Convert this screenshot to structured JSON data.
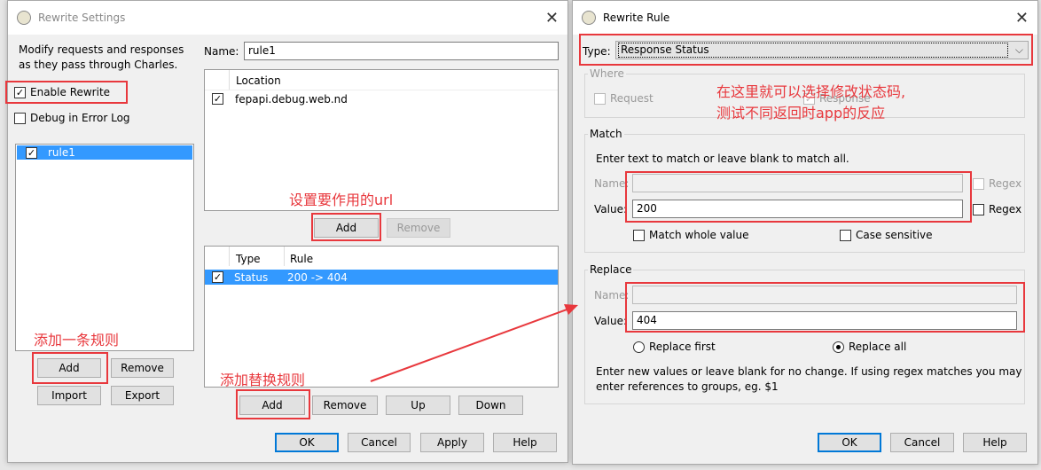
{
  "settings": {
    "title": "Rewrite Settings",
    "description_1": "Modify requests and responses",
    "description_2": "as they pass through Charles.",
    "enable_rewrite": "Enable Rewrite",
    "debug_log": "Debug in Error Log",
    "rules": [
      {
        "name": "rule1",
        "checked": true
      }
    ],
    "add": "Add",
    "remove": "Remove",
    "import": "Import",
    "export": "Export",
    "name_label": "Name:",
    "name_value": "rule1",
    "location_header": "Location",
    "locations": [
      {
        "value": "fepapi.debug.web.nd",
        "checked": true
      }
    ],
    "loc_add": "Add",
    "loc_remove": "Remove",
    "rule_headers": {
      "type": "Type",
      "rule": "Rule"
    },
    "rule_rows": [
      {
        "type": "Status",
        "rule": "200 -> 404",
        "checked": true
      }
    ],
    "rule_add": "Add",
    "rule_remove": "Remove",
    "up": "Up",
    "down": "Down",
    "ok": "OK",
    "cancel": "Cancel",
    "apply": "Apply",
    "help": "Help"
  },
  "rule": {
    "title": "Rewrite Rule",
    "type_label": "Type:",
    "type_value": "Response Status",
    "where": "Where",
    "request": "Request",
    "response": "Response",
    "match": "Match",
    "match_hint": "Enter text to match or leave blank to match all.",
    "name_label": "Name:",
    "value_label": "Value:",
    "match_value": "200",
    "regex": "Regex",
    "match_whole": "Match whole value",
    "case_sensitive": "Case sensitive",
    "replace": "Replace",
    "replace_value": "404",
    "replace_first": "Replace first",
    "replace_all": "Replace all",
    "replace_hint_1": "Enter new values or leave blank for no change. If using regex matches you may",
    "replace_hint_2": "enter references to groups, eg. $1",
    "ok": "OK",
    "cancel": "Cancel",
    "help": "Help"
  },
  "annotations": {
    "url": "设置要作用的url",
    "add_rule": "添加一条规则",
    "add_replace": "添加替换规则",
    "status_1": "在这里就可以选择修改状态码,",
    "status_2": "测试不同返回时app的反应"
  },
  "colors": {
    "accent": "#3399ff",
    "annotation": "#e8383d"
  }
}
